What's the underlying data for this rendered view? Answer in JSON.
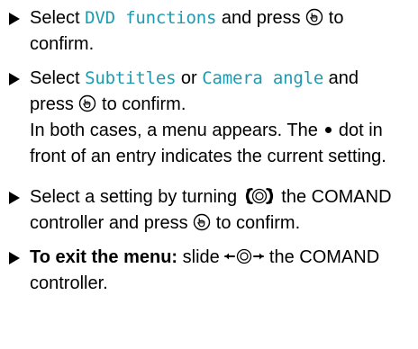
{
  "steps": [
    {
      "select": "Select",
      "item": "DVD functions",
      "and_press": "and press",
      "to_confirm": "to confirm."
    },
    {
      "select": "Select",
      "item_a": "Subtitles",
      "or": "or",
      "item_b": "Camera angle",
      "and": "and",
      "press": "press",
      "to_confirm": "to confirm.",
      "note_part1": "In both cases, a menu appears. The",
      "note_part2": "dot in front of an entry indicates the current setting."
    },
    {
      "part1": "Select a setting by turning",
      "part2": "the COMAND controller and press",
      "to_confirm": "to confirm."
    },
    {
      "bold_label": "To exit the menu:",
      "slide": "slide",
      "rest": "the COMAND controller."
    }
  ],
  "icons": {
    "press": "controller-press-icon",
    "turn": "controller-turn-icon",
    "slide": "controller-slide-left-right-icon",
    "bullet": "triangle-bullet-icon",
    "current_dot": "current-setting-dot-icon"
  },
  "colors": {
    "menu_item_text": "#1c9bb0",
    "body_text": "#000000"
  }
}
